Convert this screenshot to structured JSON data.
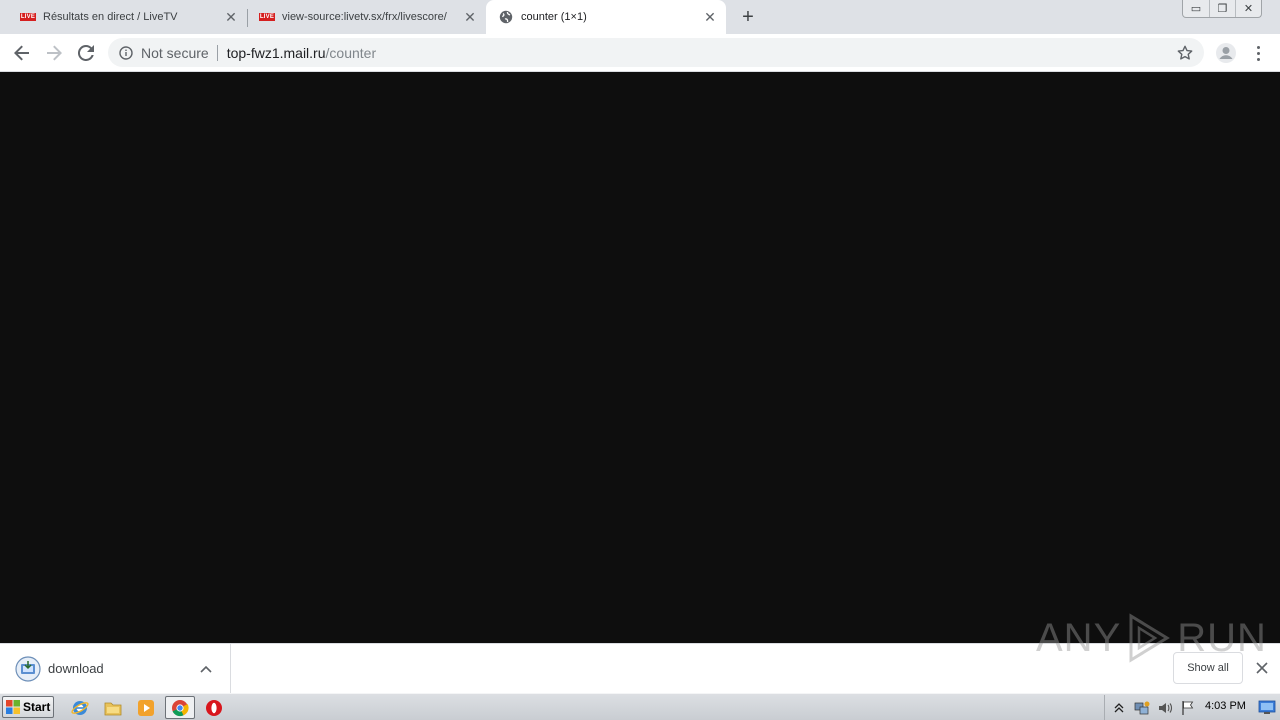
{
  "browser": {
    "tabs": [
      {
        "title": "Résultats en direct / LiveTV",
        "favicon": "live-badge-icon",
        "badge_text": "LIVE",
        "active": false
      },
      {
        "title": "view-source:livetv.sx/frx/livescore/",
        "favicon": "live-badge-icon",
        "badge_text": "LIVE",
        "active": false
      },
      {
        "title": "counter (1×1)",
        "favicon": "globe-icon",
        "active": true
      }
    ],
    "new_tab_label": "+",
    "window_controls": {
      "minimize": "▭",
      "restore": "❐",
      "close": "✕"
    }
  },
  "toolbar": {
    "security_label": "Not secure",
    "url_host": "top-fwz1.mail.ru",
    "url_path": "/counter"
  },
  "download_shelf": {
    "item_name": "download",
    "show_all_label": "Show all",
    "watermark_left": "ANY",
    "watermark_right": "RUN"
  },
  "taskbar": {
    "start_label": "Start",
    "clock": "4:03 PM",
    "pinned": [
      "internet-explorer-icon",
      "file-explorer-icon",
      "media-player-icon",
      "chrome-icon",
      "opera-icon"
    ]
  },
  "colors": {
    "content_bg": "#0e0e0e",
    "tabstrip_bg": "#dee1e6",
    "live_badge": "#d51f1f"
  }
}
